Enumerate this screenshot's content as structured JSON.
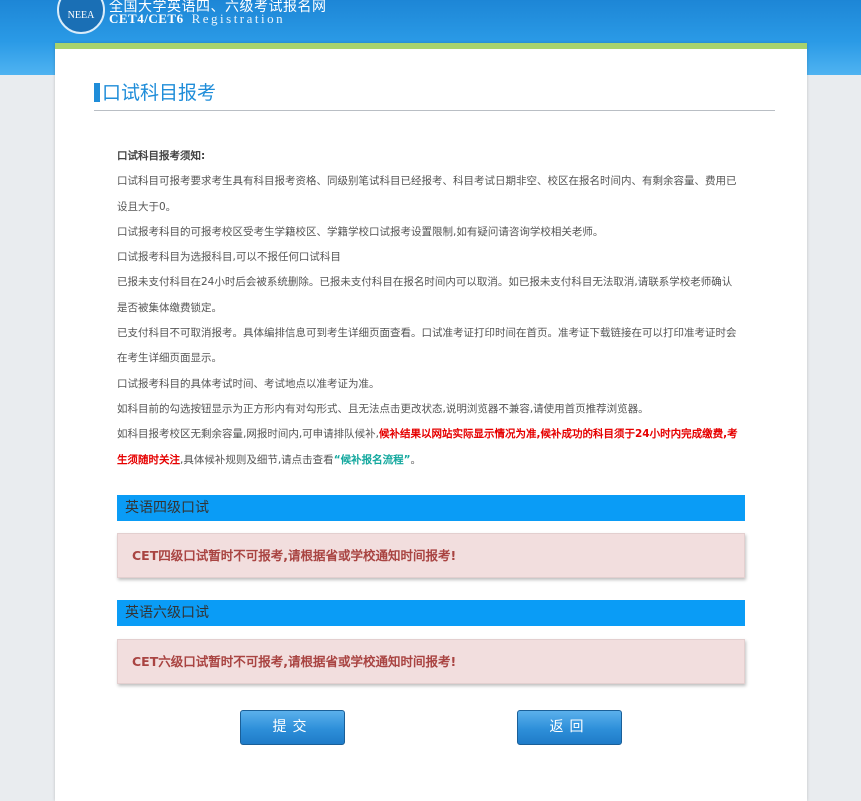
{
  "header": {
    "logo_text": "NEEA",
    "title_cn": "全国大学英语四、六级考试报名网",
    "title_en": "CET4/CET6",
    "title_registration": "Registration"
  },
  "page": {
    "title": "口试科目报考"
  },
  "notice": {
    "heading": "口试科目报考须知:",
    "p1": "口试科目可报考要求考生具有科目报考资格、同级别笔试科目已经报考、科目考试日期非空、校区在报名时间内、有剩余容量、费用已设且大于0。",
    "p2": "口试报考科目的可报考校区受考生学籍校区、学籍学校口试报考设置限制,如有疑问请咨询学校相关老师。",
    "p3": "口试报考科目为选报科目,可以不报任何口试科目",
    "p4": "已报未支付科目在24小时后会被系统删除。已报未支付科目在报名时间内可以取消。如已报未支付科目无法取消,请联系学校老师确认是否被集体缴费锁定。",
    "p5": "已支付科目不可取消报考。具体编排信息可到考生详细页面查看。口试准考证打印时间在首页。准考证下载链接在可以打印准考证时会在考生详细页面显示。",
    "p6": "口试报考科目的具体考试时间、考试地点以准考证为准。",
    "p7": "如科目前的勾选按钮显示为正方形内有对勾形式、且无法点击更改状态,说明浏览器不兼容,请使用首页推荐浏览器。",
    "p8_normal": "如科目报考校区无剩余容量,网报时间内,可申请排队候补,",
    "p8_red": "候补结果以网站实际显示情况为准,候补成功的科目须于24小时内完成缴费,考生须随时关注",
    "p8_mid": ",具体候补规则及细节,请点击查看",
    "p8_link": "“候补报名流程”",
    "p8_end": "。"
  },
  "sections": [
    {
      "title": "英语四级口试",
      "alert": "CET四级口试暂时不可报考,请根据省或学校通知时间报考!"
    },
    {
      "title": "英语六级口试",
      "alert": "CET六级口试暂时不可报考,请根据省或学校通知时间报考!"
    }
  ],
  "buttons": {
    "submit": "提交",
    "back": "返回"
  },
  "colors": {
    "accent_blue": "#1f8dd9",
    "section_blue": "#0a9cf6",
    "panel_top_green": "#a8d26d",
    "alert_bg": "#f2dede",
    "alert_text": "#a94442",
    "highlight_red": "#e60000",
    "link_teal": "#13a89e"
  }
}
